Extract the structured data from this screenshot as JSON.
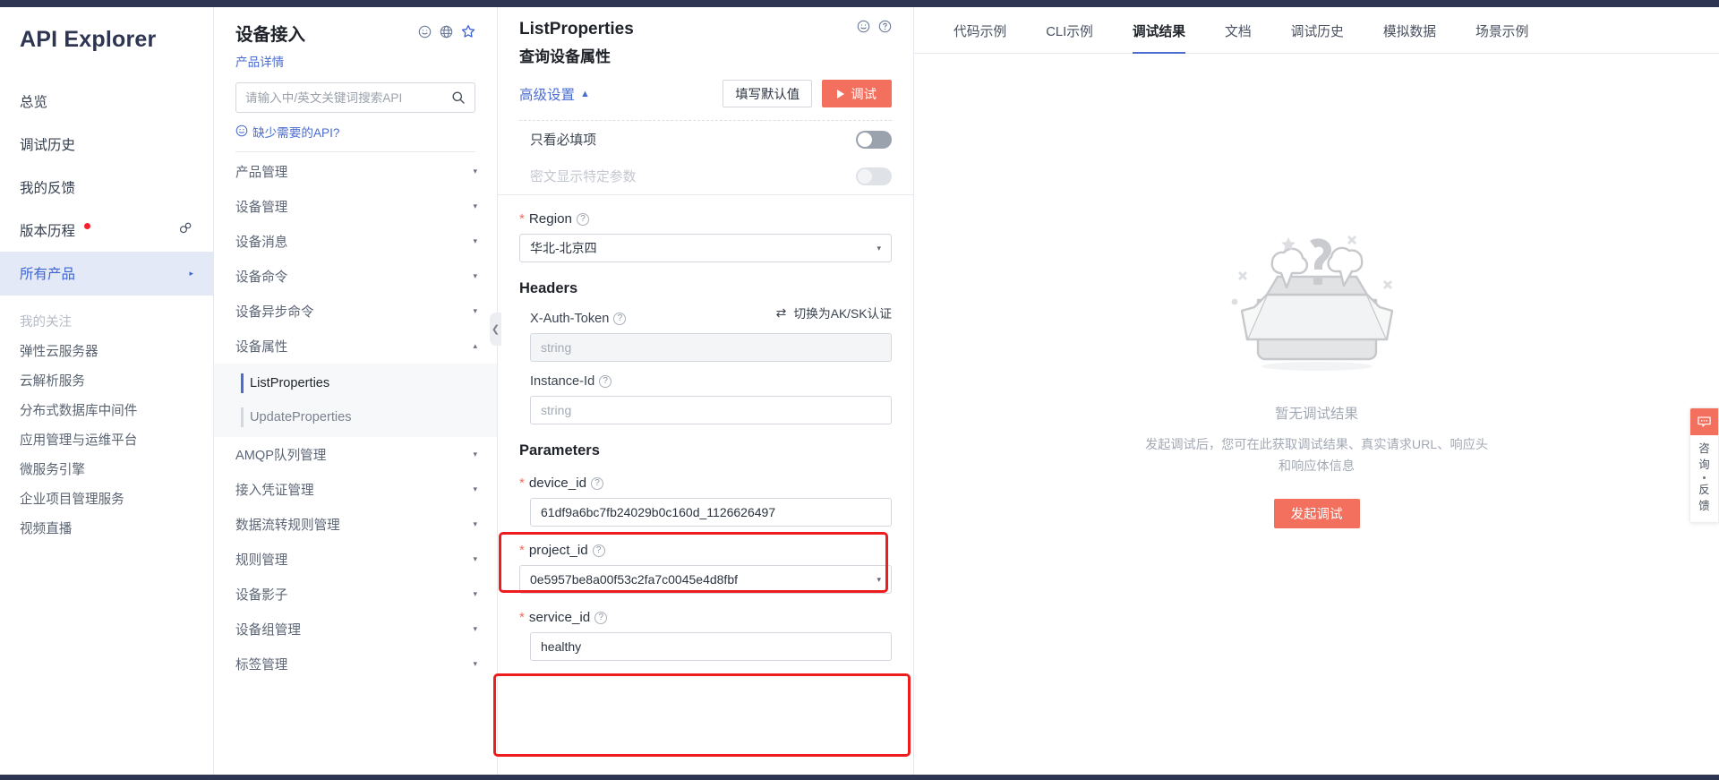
{
  "sidebar": {
    "brand": "API Explorer",
    "top_items": [
      {
        "label": "总览",
        "active": false,
        "dot": false,
        "icon": ""
      },
      {
        "label": "调试历史",
        "active": false,
        "dot": false,
        "icon": ""
      },
      {
        "label": "我的反馈",
        "active": false,
        "dot": false,
        "icon": ""
      },
      {
        "label": "版本历程",
        "active": false,
        "dot": true,
        "icon": "link-icon"
      },
      {
        "label": "所有产品",
        "active": true,
        "dot": false,
        "icon": "caret-right-icon"
      }
    ],
    "group_title": "我的关注",
    "fav_items": [
      "弹性云服务器",
      "云解析服务",
      "分布式数据库中间件",
      "应用管理与运维平台",
      "微服务引擎",
      "企业项目管理服务",
      "视频直播"
    ]
  },
  "tree": {
    "product": "设备接入",
    "header_icons": [
      "smiley-icon",
      "globe-icon",
      "star-icon"
    ],
    "product_link": "产品详情",
    "search_placeholder": "请输入中/英文关键词搜索API",
    "missing_api": "缺少需要的API?",
    "groups": [
      {
        "label": "产品管理",
        "expanded": false,
        "children": []
      },
      {
        "label": "设备管理",
        "expanded": false,
        "children": []
      },
      {
        "label": "设备消息",
        "expanded": false,
        "children": []
      },
      {
        "label": "设备命令",
        "expanded": false,
        "children": []
      },
      {
        "label": "设备异步命令",
        "expanded": false,
        "children": []
      },
      {
        "label": "设备属性",
        "expanded": true,
        "children": [
          {
            "label": "ListProperties",
            "selected": true
          },
          {
            "label": "UpdateProperties",
            "selected": false
          }
        ]
      },
      {
        "label": "AMQP队列管理",
        "expanded": false,
        "children": []
      },
      {
        "label": "接入凭证管理",
        "expanded": false,
        "children": []
      },
      {
        "label": "数据流转规则管理",
        "expanded": false,
        "children": []
      },
      {
        "label": "规则管理",
        "expanded": false,
        "children": []
      },
      {
        "label": "设备影子",
        "expanded": false,
        "children": []
      },
      {
        "label": "设备组管理",
        "expanded": false,
        "children": []
      },
      {
        "label": "标签管理",
        "expanded": false,
        "children": []
      }
    ]
  },
  "form": {
    "api_name": "ListProperties",
    "api_cn": "查询设备属性",
    "header_icons": [
      "smiley-icon",
      "help-icon"
    ],
    "advanced_label": "高级设置",
    "fill_default_label": "填写默认值",
    "debug_label": "调试",
    "toggles": [
      {
        "label": "只看必填项",
        "on": false,
        "style": "dark",
        "disabled": false
      },
      {
        "label": "密文显示特定参数",
        "on": false,
        "style": "light",
        "disabled": true
      }
    ],
    "region": {
      "label": "Region",
      "required": true,
      "value": "华北-北京四"
    },
    "headers_title": "Headers",
    "switch_auth_label": "切换为AK/SK认证",
    "headers": [
      {
        "label": "X-Auth-Token",
        "required": false,
        "value": "",
        "placeholder": "string",
        "grey": true
      },
      {
        "label": "Instance-Id",
        "required": false,
        "value": "",
        "placeholder": "string",
        "grey": false
      }
    ],
    "parameters_title": "Parameters",
    "parameters": [
      {
        "label": "device_id",
        "required": true,
        "value": "61df9a6bc7fb24029b0c160d_1126626497",
        "placeholder": "",
        "type": "text",
        "highlighted": true
      },
      {
        "label": "project_id",
        "required": true,
        "value": "0e5957be8a00f53c2fa7c0045e4d8fbf",
        "placeholder": "",
        "type": "select",
        "highlighted": false
      },
      {
        "label": "service_id",
        "required": true,
        "value": "healthy",
        "placeholder": "",
        "type": "text",
        "highlighted": true
      }
    ]
  },
  "right": {
    "tabs": [
      {
        "label": "代码示例",
        "active": false
      },
      {
        "label": "CLI示例",
        "active": false
      },
      {
        "label": "调试结果",
        "active": true
      },
      {
        "label": "文档",
        "active": false
      },
      {
        "label": "调试历史",
        "active": false
      },
      {
        "label": "模拟数据",
        "active": false
      },
      {
        "label": "场景示例",
        "active": false
      }
    ],
    "empty_title": "暂无调试结果",
    "empty_desc": "发起调试后，您可在此获取调试结果、真实请求URL、响应头和响应体信息",
    "empty_button": "发起调试"
  },
  "float_widget": {
    "icon": "chat-bubble-icon",
    "lines": [
      "咨",
      "询",
      "·",
      "反",
      "馈"
    ],
    "color": "#f4705e"
  },
  "colors": {
    "accent_blue": "#4b6cd1",
    "accent_red": "#f4705e",
    "highlight_red": "#ee1c1c",
    "dark_navy": "#2e3552",
    "required_star": "#f26d5b"
  }
}
